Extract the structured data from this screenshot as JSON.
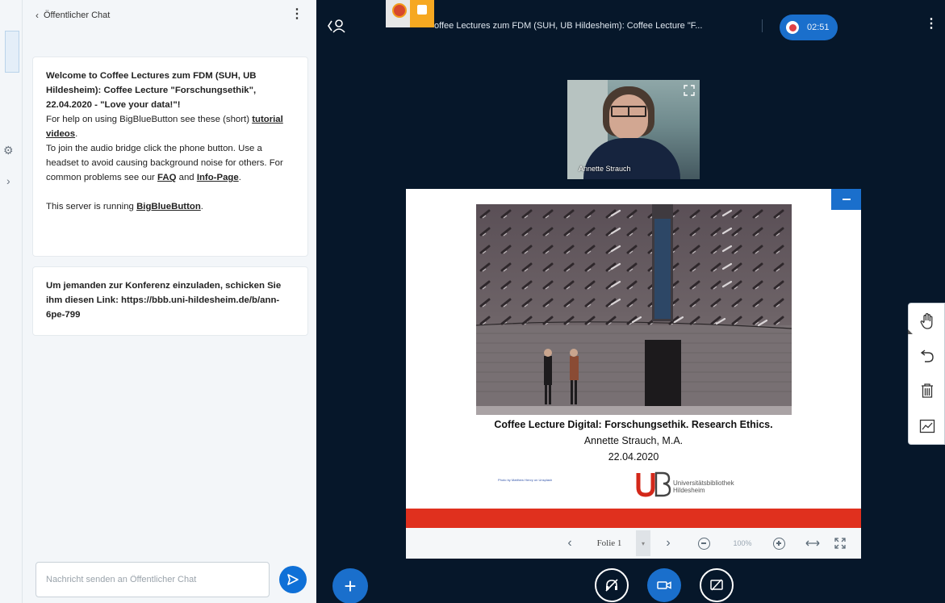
{
  "chat": {
    "header_title": "Öffentlicher Chat",
    "welcome": {
      "heading": "Welcome to Coffee Lectures zum FDM (SUH, UB Hildesheim): Coffee Lecture \"Forschungsethik\", 22.04.2020 - \"Love your data!\"!",
      "help_prefix": "For help on using BigBlueButton see these (short)",
      "help_link": "tutorial videos",
      "help_suffix": ".",
      "audio": "To join the audio bridge click the phone button. Use a headset to avoid causing background noise for others. For common problems see our",
      "faq_link": "FAQ",
      "and": "and",
      "info_link": "Info-Page",
      "info_suffix": ".",
      "server_prefix": "This server is running",
      "server_link": "BigBlueButton",
      "server_suffix": "."
    },
    "invite": "Um jemanden zur Konferenz einzuladen, schicken Sie ihm diesen Link: https://bbb.uni-hildesheim.de/b/ann-6pe-799",
    "input_placeholder": "Nachricht senden an Öffentlicher Chat"
  },
  "topbar": {
    "meeting_title": "offee Lectures zum FDM (SUH, UB Hildesheim): Coffee Lecture \"F...",
    "recording_time": "02:51"
  },
  "webcam": {
    "name": "Annette Strauch"
  },
  "slide": {
    "title": "Coffee Lecture Digital: Forschungsethik. Research Ethics.",
    "author": "Annette Strauch, M.A.",
    "date": "22.04.2020",
    "photo_credit": "Photo by Matthew Henry on Unsplash",
    "logo_text_line1": "Universitätsbibliothek",
    "logo_text_line2": "Hildesheim"
  },
  "slide_controls": {
    "slide_label": "Folie 1",
    "zoom": "100%"
  },
  "colors": {
    "accent": "#1a6fcc",
    "background": "#06172a",
    "slide_red": "#e0301e"
  }
}
